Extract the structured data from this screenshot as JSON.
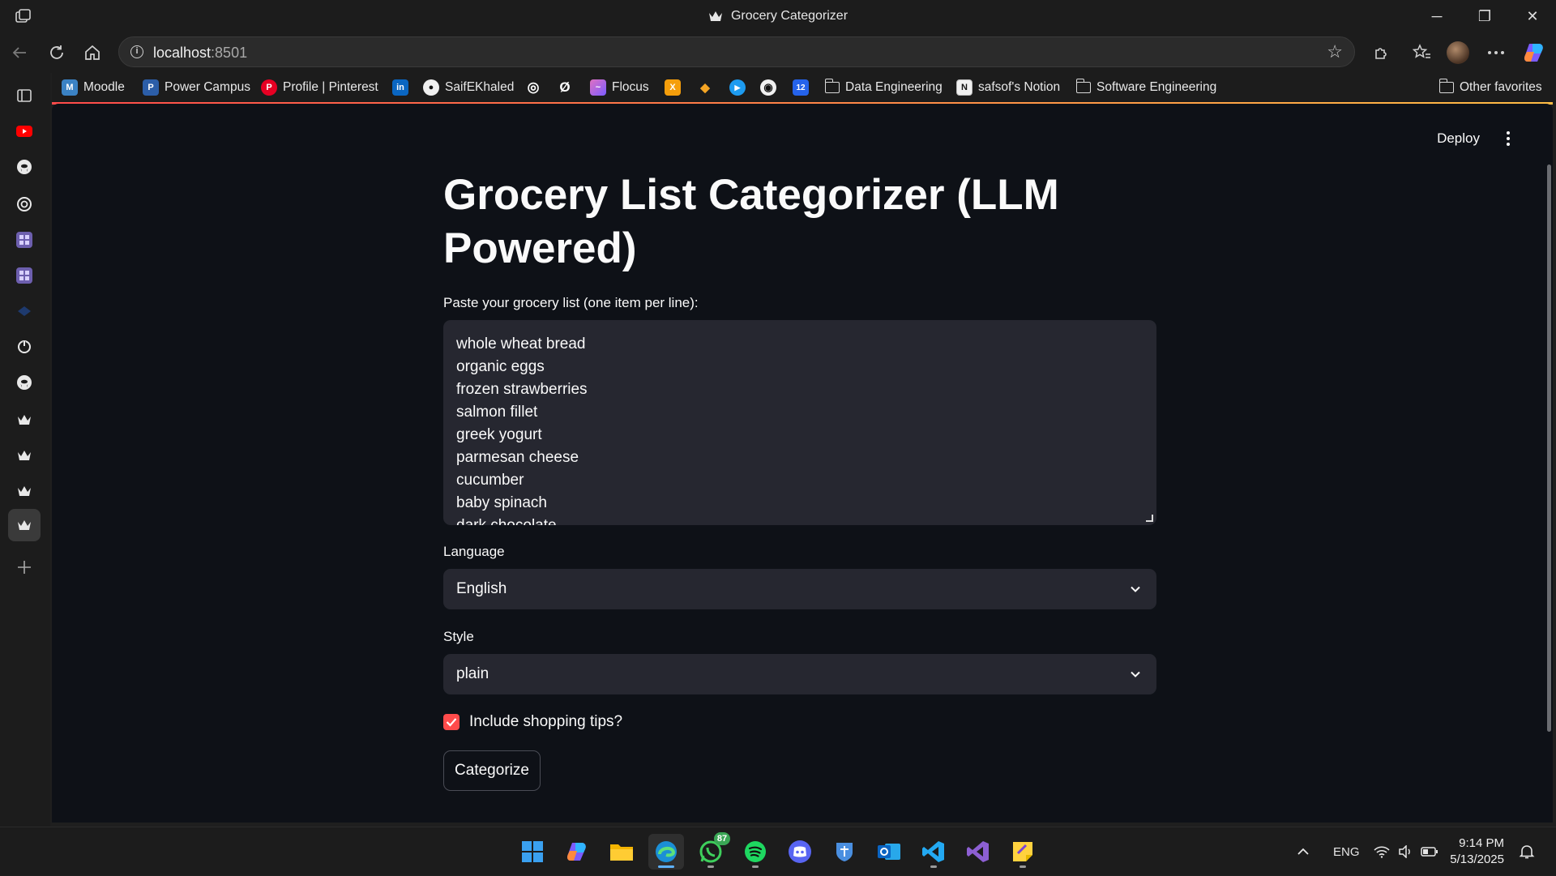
{
  "window": {
    "title": "Grocery Categorizer",
    "minimize_glyph": "─",
    "maximize_glyph": "❐",
    "close_glyph": "✕"
  },
  "browser": {
    "url_host": "localhost",
    "url_port": ":8501",
    "info_glyph": "i",
    "star_glyph": "☆"
  },
  "favorites": [
    {
      "label": "Moodle",
      "icon": "moodle-icon",
      "color": "#3b82c4",
      "glyph": "M"
    },
    {
      "label": "Power Campus",
      "icon": "powercampus-icon",
      "color": "#2c5ea8",
      "glyph": "P"
    },
    {
      "label": "Profile | Pinterest",
      "icon": "pinterest-icon",
      "color": "#e60023",
      "glyph": "P"
    },
    {
      "label": "",
      "icon": "linkedin-icon",
      "color": "#0a66c2",
      "glyph": "in"
    },
    {
      "label": "SaifEKhaled",
      "icon": "github-icon",
      "color": "#2b2b2b",
      "glyph": "●"
    },
    {
      "label": "",
      "icon": "chatgpt-icon",
      "color": "#2b2b2b",
      "glyph": "◎"
    },
    {
      "label": "",
      "icon": "slash-icon",
      "color": "#2b2b2b",
      "glyph": "Ø"
    },
    {
      "label": "Flocus",
      "icon": "flocus-icon",
      "color": "#b85fb8",
      "glyph": "~"
    },
    {
      "label": "",
      "icon": "x-app-icon",
      "color": "#f59e0b",
      "glyph": "X"
    },
    {
      "label": "",
      "icon": "triangle-app-icon",
      "color": "#2b2b2b",
      "glyph": "◆"
    },
    {
      "label": "",
      "icon": "play-app-icon",
      "color": "#1d9bf0",
      "glyph": "▶"
    },
    {
      "label": "",
      "icon": "circle-app-icon",
      "color": "#2b2b2b",
      "glyph": "◉"
    },
    {
      "label": "",
      "icon": "calendar-12-icon",
      "color": "#2563eb",
      "glyph": "12"
    },
    {
      "label": "Data Engineering",
      "icon": "folder-icon",
      "color": "",
      "glyph": ""
    },
    {
      "label": "safsof's Notion",
      "icon": "notion-icon",
      "color": "#2b2b2b",
      "glyph": "N"
    },
    {
      "label": "Software Engineering",
      "icon": "folder-icon",
      "color": "",
      "glyph": ""
    }
  ],
  "other_favorites": "Other favorites",
  "app": {
    "deploy_label": "Deploy",
    "title": "Grocery List Categorizer (LLM Powered)",
    "textarea_label": "Paste your grocery list (one item per line):",
    "grocery_lines": [
      "whole wheat bread",
      "organic eggs",
      "frozen strawberries",
      "salmon fillet",
      "greek yogurt",
      "parmesan cheese",
      "cucumber",
      "baby spinach",
      "dark chocolate"
    ],
    "language_label": "Language",
    "language_value": "English",
    "style_label": "Style",
    "style_value": "plain",
    "tips_label": "Include shopping tips?",
    "tips_checked": true,
    "categorize_label": "Categorize",
    "accent_color": "#ff4b4b"
  },
  "taskbar": {
    "whatsapp_badge": "87",
    "tray_language": "ENG",
    "time": "9:14 PM",
    "date": "5/13/2025"
  }
}
